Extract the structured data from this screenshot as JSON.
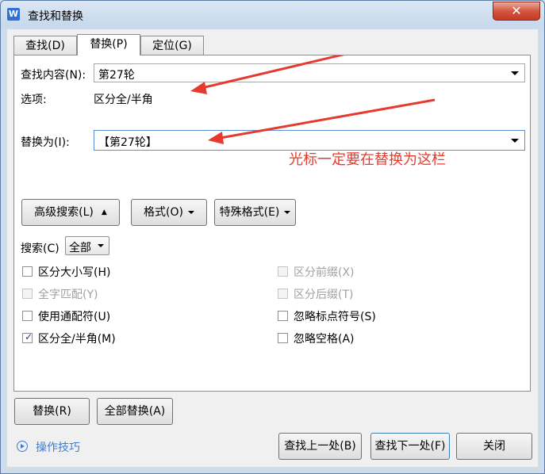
{
  "window": {
    "title": "查找和替换",
    "app_icon": "W"
  },
  "tabs": [
    {
      "label": "查找(D)",
      "active": false
    },
    {
      "label": "替换(P)",
      "active": true
    },
    {
      "label": "定位(G)",
      "active": false
    }
  ],
  "find": {
    "label": "查找内容(N):",
    "value": "第27轮"
  },
  "options": {
    "label": "选项:",
    "value": "区分全/半角"
  },
  "replace": {
    "label": "替换为(I):",
    "value": "【第27轮】"
  },
  "annotation": {
    "text": "光标一定要在替换为这栏",
    "color": "#e63a2e"
  },
  "buttons": {
    "advanced": "高级搜索(L)",
    "format": "格式(O)",
    "special": "特殊格式(E)",
    "replace": "替换(R)",
    "replace_all": "全部替换(A)",
    "find_prev": "查找上一处(B)",
    "find_next": "查找下一处(F)",
    "close": "关闭"
  },
  "search": {
    "label": "搜索(C)",
    "value": "全部"
  },
  "checkboxes": [
    {
      "label": "区分大小写(H)",
      "checked": false,
      "disabled": false
    },
    {
      "label": "全字匹配(Y)",
      "checked": false,
      "disabled": true
    },
    {
      "label": "使用通配符(U)",
      "checked": false,
      "disabled": false
    },
    {
      "label": "区分全/半角(M)",
      "checked": true,
      "disabled": false
    },
    {
      "label": "区分前缀(X)",
      "checked": false,
      "disabled": true
    },
    {
      "label": "区分后缀(T)",
      "checked": false,
      "disabled": true
    },
    {
      "label": "忽略标点符号(S)",
      "checked": false,
      "disabled": false
    },
    {
      "label": "忽略空格(A)",
      "checked": false,
      "disabled": false
    }
  ],
  "tips": {
    "label": "操作技巧"
  }
}
